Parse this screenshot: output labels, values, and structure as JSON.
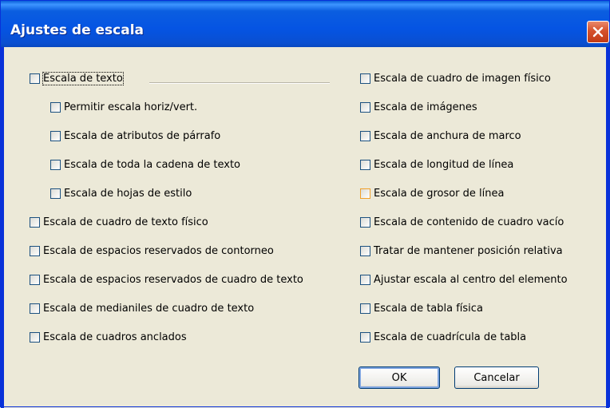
{
  "window": {
    "title": "Ajustes de escala"
  },
  "options_left": [
    {
      "label": "Escala de texto",
      "checked": true
    },
    {
      "label": "Permitir escala horiz/vert.",
      "checked": true
    },
    {
      "label": "Escala de atributos de párrafo",
      "checked": true
    },
    {
      "label": "Escala de toda la cadena de texto",
      "checked": true
    },
    {
      "label": "Escala de hojas de estilo",
      "checked": false
    },
    {
      "label": "Escala de cuadro de texto físico",
      "checked": true
    },
    {
      "label": "Escala de espacios reservados de contorneo",
      "checked": true
    },
    {
      "label": "Escala de espacios reservados de cuadro de texto",
      "checked": true
    },
    {
      "label": "Escala de medianiles de cuadro de texto",
      "checked": true
    },
    {
      "label": "Escala de cuadros anclados",
      "checked": true
    }
  ],
  "options_right": [
    {
      "label": "Escala de cuadro de imagen físico",
      "checked": true
    },
    {
      "label": "Escala de imágenes",
      "checked": true
    },
    {
      "label": "Escala de anchura de marco",
      "checked": true
    },
    {
      "label": "Escala de longitud de línea",
      "checked": true
    },
    {
      "label": "Escala de grosor de línea",
      "checked": true
    },
    {
      "label": "Escala de contenido de cuadro vacío",
      "checked": false
    },
    {
      "label": "Tratar de mantener posición relativa",
      "checked": false
    },
    {
      "label": "Ajustar escala al centro del elemento",
      "checked": false
    },
    {
      "label": "Escala de tabla física",
      "checked": true
    },
    {
      "label": "Escala de cuadrícula de tabla",
      "checked": true
    }
  ],
  "buttons": {
    "ok": "OK",
    "cancel": "Cancelar"
  },
  "colors": {
    "titlebar": "#0554e3",
    "dialog_bg": "#ece9d8",
    "check": "#21a121"
  }
}
